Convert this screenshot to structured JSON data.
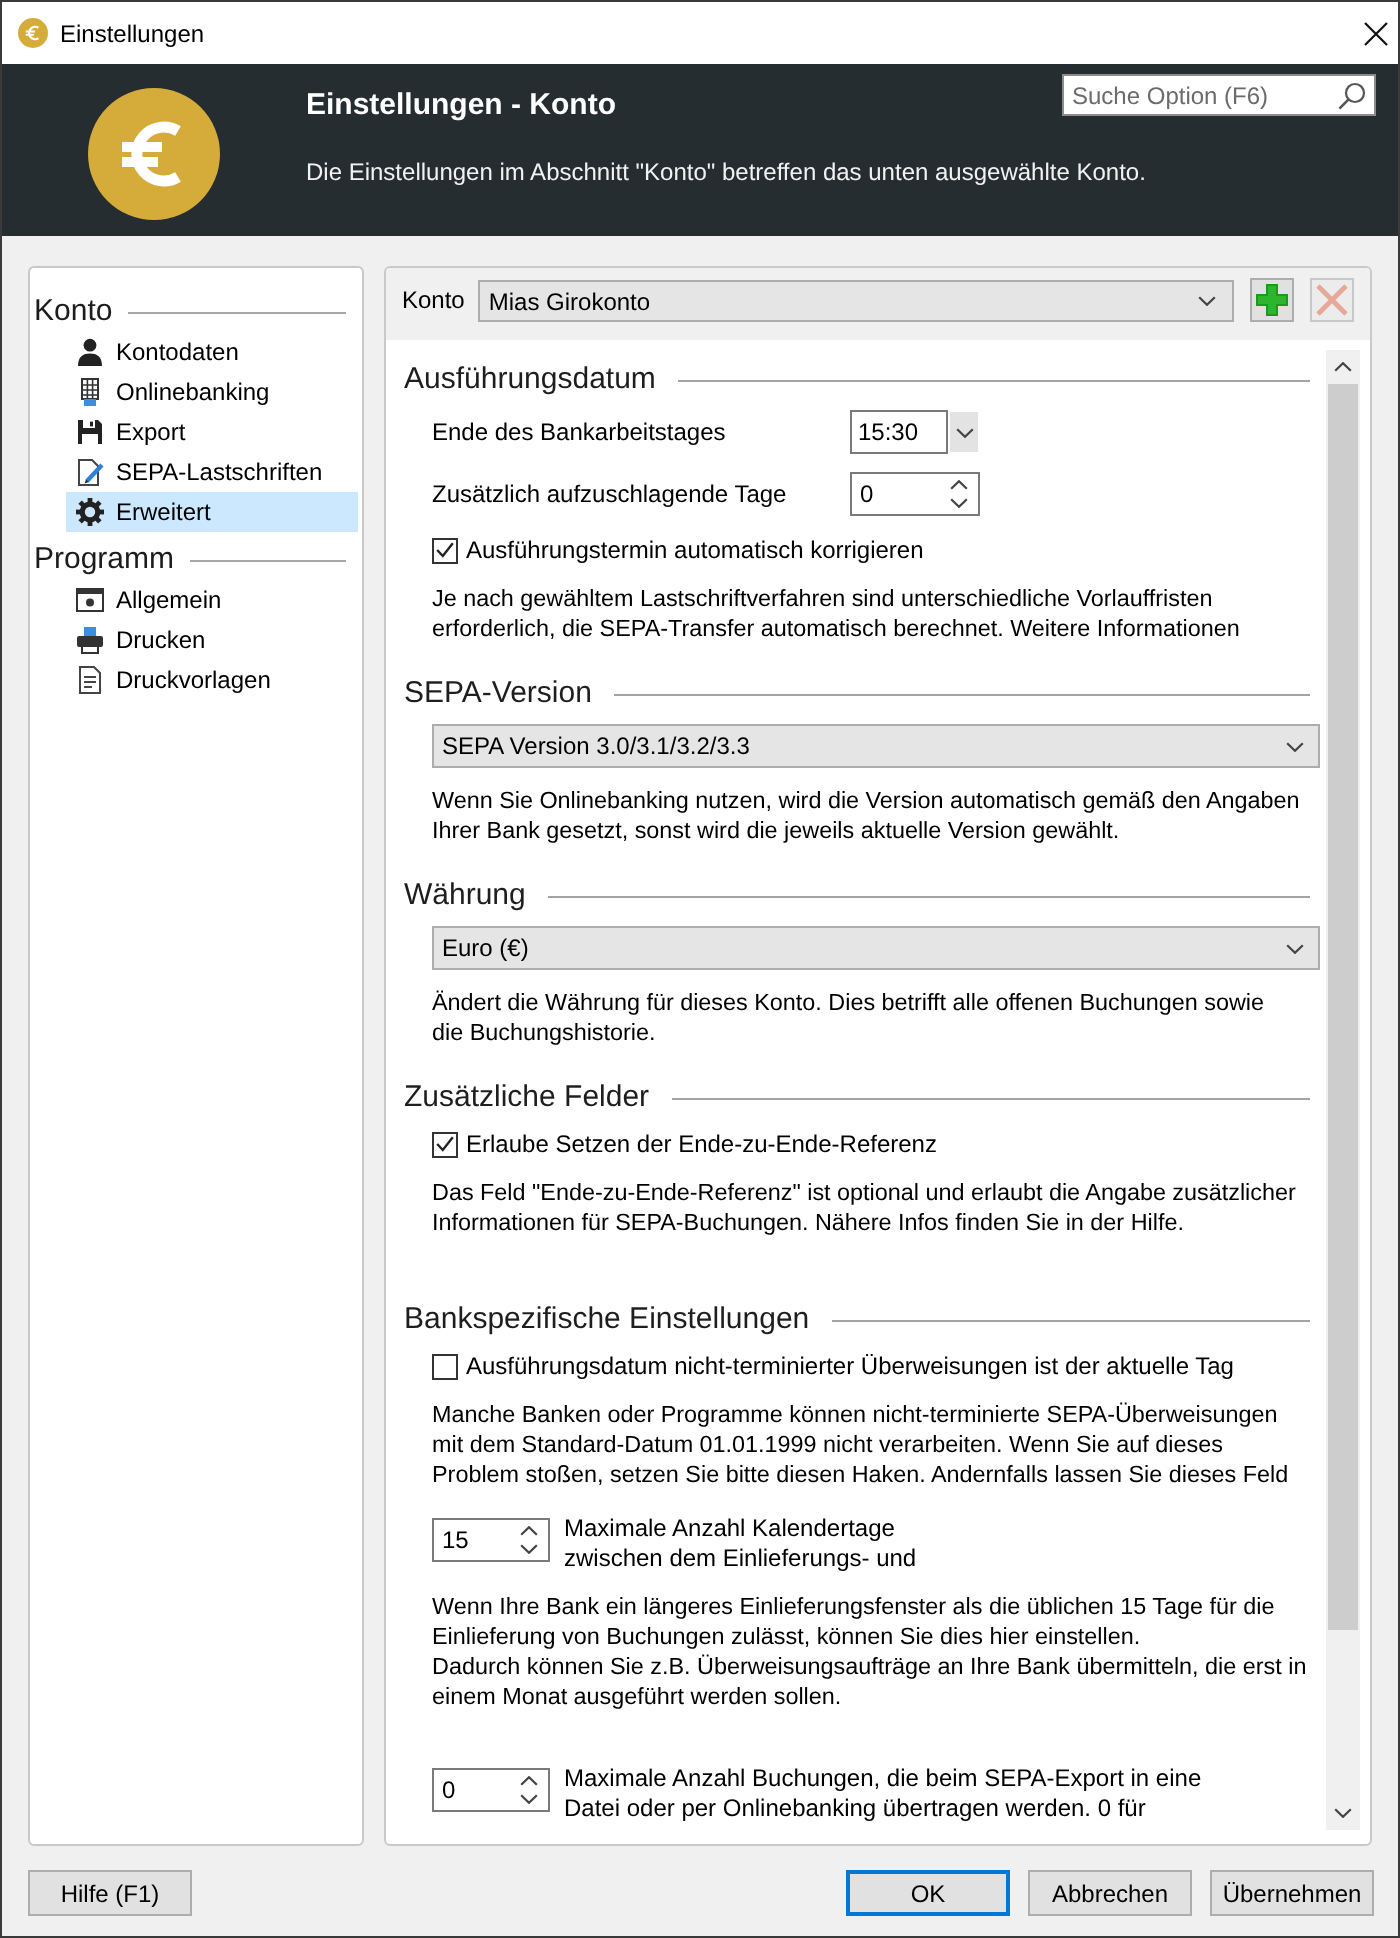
{
  "window": {
    "title": "Einstellungen"
  },
  "header": {
    "title": "Einstellungen - Konto",
    "description": "Die Einstellungen im Abschnitt \"Konto\" betreffen das unten ausgewählte Konto.",
    "search": {
      "placeholder": "Suche Option (F6)"
    }
  },
  "sidebar": {
    "groups": [
      {
        "label": "Konto",
        "items": [
          {
            "label": "Kontodaten",
            "selected": false
          },
          {
            "label": "Onlinebanking",
            "selected": false
          },
          {
            "label": "Export",
            "selected": false
          },
          {
            "label": "SEPA-Lastschriften",
            "selected": false
          },
          {
            "label": "Erweitert",
            "selected": true
          }
        ]
      },
      {
        "label": "Programm",
        "items": [
          {
            "label": "Allgemein",
            "selected": false
          },
          {
            "label": "Drucken",
            "selected": false
          },
          {
            "label": "Druckvorlagen",
            "selected": false
          }
        ]
      }
    ]
  },
  "account_bar": {
    "label": "Konto",
    "account": "Mias Girokonto",
    "add_button": {
      "disabled": false
    },
    "remove_button": {
      "disabled": true
    }
  },
  "sections": [
    {
      "title": "Ausführungsdatum",
      "rows": [
        {
          "kind": "time",
          "label": "Ende des Bankarbeitstages",
          "value": "15:30"
        },
        {
          "kind": "spinner",
          "label": "Zusätzlich aufzuschlagende Tage",
          "value": "0"
        },
        {
          "kind": "checkbox",
          "label": "Ausführungstermin automatisch korrigieren",
          "checked": true
        },
        {
          "kind": "note",
          "text": "Je nach gewähltem Lastschriftverfahren sind unterschiedliche Vorlauffristen\nerforderlich, die SEPA-Transfer automatisch berechnet. Weitere Informationen"
        }
      ]
    },
    {
      "title": "SEPA-Version",
      "rows": [
        {
          "kind": "dropdown",
          "value": "SEPA Version 3.0/3.1/3.2/3.3"
        },
        {
          "kind": "note",
          "text": "Wenn Sie Onlinebanking nutzen, wird die Version automatisch gemäß den Angaben\nIhrer Bank gesetzt, sonst wird die jeweils aktuelle Version gewählt."
        }
      ]
    },
    {
      "title": "Währung",
      "rows": [
        {
          "kind": "dropdown",
          "value": "Euro (€)"
        },
        {
          "kind": "note",
          "text": "Ändert die Währung für dieses Konto. Dies betrifft alle offenen Buchungen sowie\ndie Buchungshistorie."
        }
      ]
    },
    {
      "title": "Zusätzliche Felder",
      "rows": [
        {
          "kind": "checkbox",
          "label": "Erlaube Setzen der Ende-zu-Ende-Referenz",
          "checked": true
        },
        {
          "kind": "note",
          "text": "Das Feld \"Ende-zu-Ende-Referenz\" ist optional und erlaubt die Angabe zusätzlicher\nInformationen für SEPA-Buchungen. Nähere Infos finden Sie in der Hilfe."
        }
      ]
    },
    {
      "title": "Bankspezifische Einstellungen",
      "rows": [
        {
          "kind": "checkbox",
          "label": "Ausführungsdatum nicht-terminierter Überweisungen ist der aktuelle Tag",
          "checked": false
        },
        {
          "kind": "note",
          "text": "Manche Banken oder Programme können nicht-terminierte SEPA-Überweisungen\nmit dem Standard-Datum 01.01.1999 nicht verarbeiten. Wenn Sie auf dieses\nProblem stoßen, setzen Sie bitte diesen Haken. Andernfalls lassen Sie dieses Feld"
        },
        {
          "kind": "spinner_first",
          "value": "15",
          "label": "Maximale Anzahl Kalendertage\nzwischen dem Einlieferungs- und"
        },
        {
          "kind": "note",
          "text": "Wenn Ihre Bank ein längeres Einlieferungsfenster als die üblichen 15 Tage für die\nEinlieferung von Buchungen zulässt, können Sie dies hier einstellen.\nDadurch können Sie z.B. Überweisungsaufträge an Ihre Bank übermitteln, die erst in\neinem Monat ausgeführt werden sollen."
        },
        {
          "kind": "spinner_first",
          "value": "0",
          "label": "Maximale Anzahl Buchungen, die beim SEPA-Export in eine\nDatei oder per Onlinebanking übertragen werden. 0 für"
        }
      ]
    }
  ],
  "buttons": [
    {
      "label": "Hilfe (F1)",
      "default": false
    },
    {
      "label": "OK",
      "default": true
    },
    {
      "label": "Abbrechen",
      "default": false
    },
    {
      "label": "Übernehmen",
      "default": false
    }
  ]
}
